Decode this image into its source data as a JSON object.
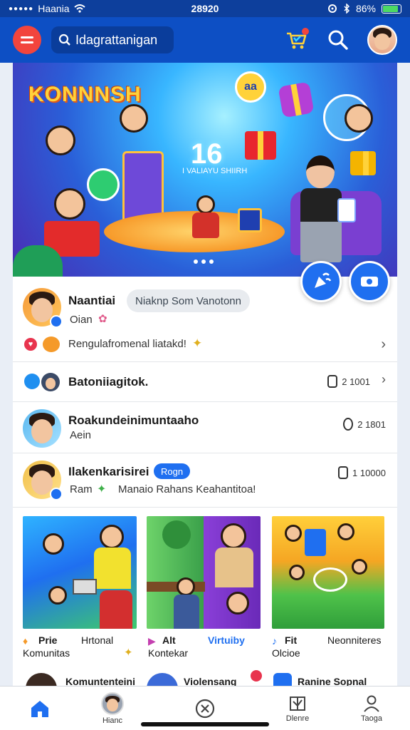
{
  "status_bar": {
    "carrier": "Haania",
    "time": "28920",
    "battery": "86%",
    "battery_level": 0.86
  },
  "header": {
    "search_text": "Idagrattanigan"
  },
  "hero": {
    "title": "KONNNSH",
    "number": "16",
    "subtitle": "I VALIAYU SHIIRH",
    "bubble_text": "aa"
  },
  "posts": [
    {
      "name": "Naantiai",
      "pill": "Niaknp Som Vanotonn",
      "sub": "Oian",
      "line": "Rengulafromenal liatakd!"
    },
    {
      "name": "Batoniiagitok.",
      "count": "2 1001"
    },
    {
      "name": "Roakundeinimuntaaho",
      "sub": "Aein",
      "count": "2 1801"
    },
    {
      "name": "Ilakenkarisirei",
      "tag": "Rogn",
      "sub": "Ram",
      "line": "Manaio Rahans Keahantitoa!",
      "count": "1 10000"
    }
  ],
  "tiles": [
    {
      "caption": "Prie",
      "caption2": "Hrtonal",
      "sub": "Komunitas"
    },
    {
      "caption": "Alt",
      "caption2": "Virtuiby",
      "sub": "Kontekar"
    },
    {
      "caption": "Fit",
      "caption2": "Neonniteres",
      "sub": "Olcioe"
    }
  ],
  "bottom_strip": [
    "Komuntenteini",
    "Violensang",
    "Ranine Sopnal"
  ],
  "nav": [
    {
      "label": ""
    },
    {
      "label": "Hianc"
    },
    {
      "label": ""
    },
    {
      "label": "Dlenre"
    },
    {
      "label": "Taoga"
    }
  ],
  "colors": {
    "header": "#0d4fc4",
    "accent": "#1f6ff0",
    "menu": "#f2453d"
  }
}
